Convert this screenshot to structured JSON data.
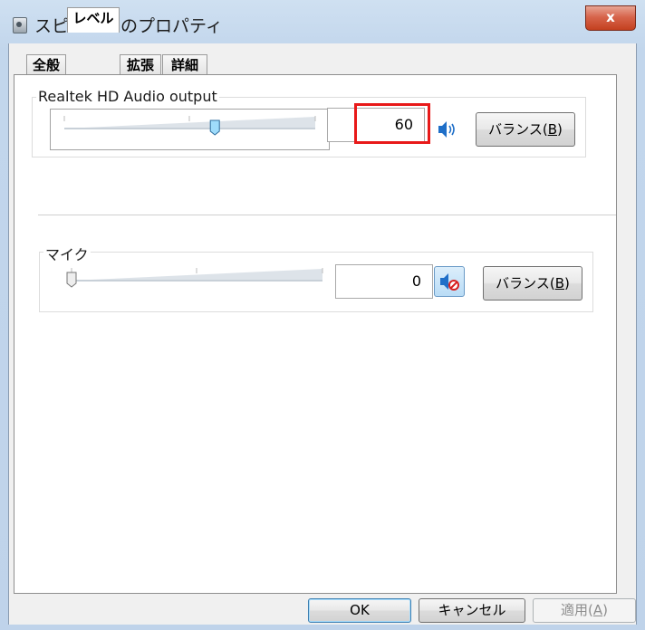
{
  "window": {
    "title": "スピーカーのプロパティ",
    "close_label": "x",
    "icon": "speaker-properties-icon"
  },
  "tabs": [
    {
      "label": "全般",
      "active": false
    },
    {
      "label": "レベル",
      "active": true
    },
    {
      "label": "拡張",
      "active": false
    },
    {
      "label": "詳細",
      "active": false
    }
  ],
  "devices": [
    {
      "name": "Realtek HD Audio output",
      "level": 60,
      "level_text": "60",
      "speaker_icon": "speaker-on-icon",
      "balance_prefix": "バランス(",
      "balance_key": "B",
      "balance_suffix": ")"
    },
    {
      "name": "マイク",
      "level": 0,
      "level_text": "0",
      "speaker_icon": "speaker-muted-icon",
      "balance_prefix": "バランス(",
      "balance_key": "B",
      "balance_suffix": ")"
    }
  ],
  "footer": {
    "ok_label": "OK",
    "cancel_label": "キャンセル",
    "apply_prefix": "適用(",
    "apply_key": "A",
    "apply_suffix": ")",
    "apply_enabled": false
  },
  "colors": {
    "highlight": "#e81919",
    "speaker_blue": "#1f6fc8",
    "muted_red": "#d82020"
  }
}
